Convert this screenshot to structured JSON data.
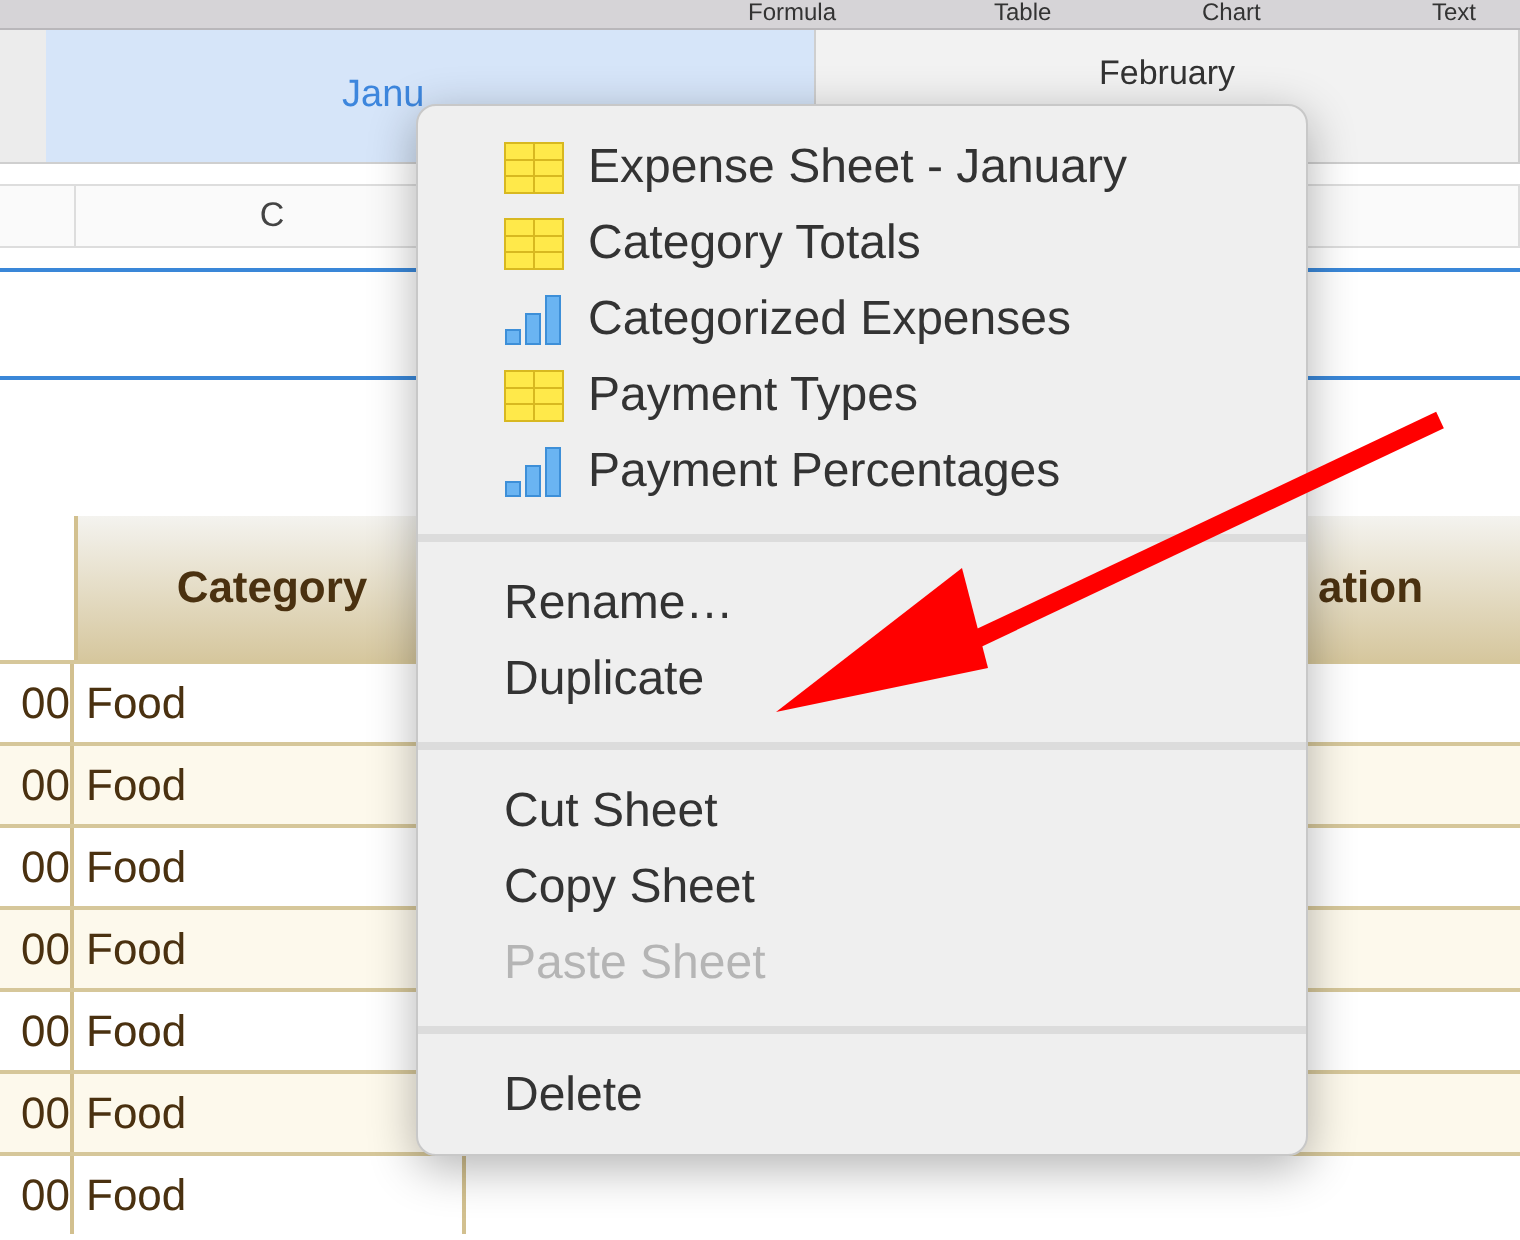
{
  "toolbar": {
    "items": [
      "Formula",
      "Table",
      "Chart",
      "Text"
    ]
  },
  "sheet_tabs": [
    {
      "label": "Janu",
      "selected": true
    },
    {
      "label": "February",
      "selected": false
    }
  ],
  "column_headers": [
    "C"
  ],
  "table": {
    "columns": [
      "Category",
      "ation"
    ],
    "rows": [
      {
        "column_1": "00",
        "category": "Food"
      },
      {
        "column_1": "00",
        "category": "Food"
      },
      {
        "column_1": "00",
        "category": "Food"
      },
      {
        "column_1": "00",
        "category": "Food"
      },
      {
        "column_1": "00",
        "category": "Food"
      },
      {
        "column_1": "00",
        "category": "Food"
      },
      {
        "column_1": "00",
        "category": "Food"
      }
    ]
  },
  "context_menu": {
    "sections": [
      [
        {
          "label": "Expense Sheet - January",
          "kind": "table",
          "disabled": false
        },
        {
          "label": "Category Totals",
          "kind": "table",
          "disabled": false
        },
        {
          "label": "Categorized Expenses",
          "kind": "chart",
          "disabled": false
        },
        {
          "label": "Payment Types",
          "kind": "table",
          "disabled": false
        },
        {
          "label": "Payment Percentages",
          "kind": "chart",
          "disabled": false
        }
      ],
      [
        {
          "label": "Rename…",
          "kind": "action",
          "disabled": false
        },
        {
          "label": "Duplicate",
          "kind": "action",
          "disabled": false
        }
      ],
      [
        {
          "label": "Cut Sheet",
          "kind": "action",
          "disabled": false
        },
        {
          "label": "Copy Sheet",
          "kind": "action",
          "disabled": false
        },
        {
          "label": "Paste Sheet",
          "kind": "action",
          "disabled": true
        }
      ],
      [
        {
          "label": "Delete",
          "kind": "action",
          "disabled": false
        }
      ]
    ]
  }
}
